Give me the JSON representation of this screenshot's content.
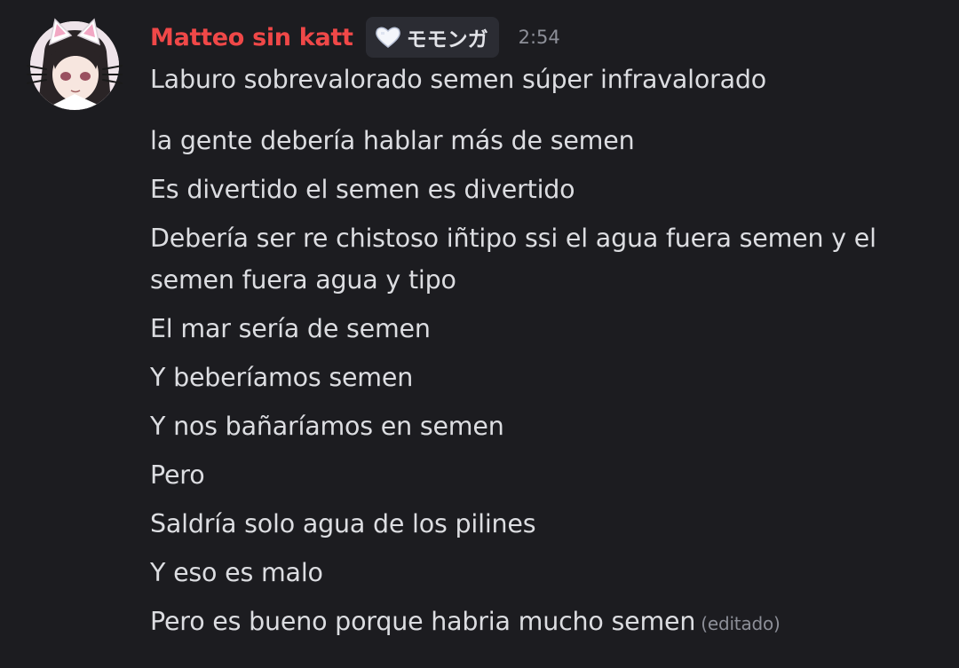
{
  "message": {
    "author": "Matteo sin katt",
    "tag": {
      "icon": "white-heart-icon",
      "text": "モモンガ"
    },
    "timestamp": "2:54",
    "lines": [
      "Laburo sobrevalorado semen súper infravalorado",
      "la gente debería hablar más de semen",
      "Es divertido el semen es divertido",
      "Debería ser re chistoso iñtipo ssi el agua fuera semen y el semen fuera agua y tipo",
      "El mar sería de semen",
      "Y beberíamos semen",
      "Y nos bañaríamos en semen",
      "Pero",
      "Saldría solo agua de los pilines",
      "Y eso es malo",
      "Pero es bueno porque habria mucho semen"
    ],
    "edited_label": "(editado)"
  },
  "colors": {
    "background": "#1c1c20",
    "username": "#f04848",
    "text": "#dcdde1",
    "muted": "#8d8f98",
    "tag_bg": "#2b2c33"
  }
}
